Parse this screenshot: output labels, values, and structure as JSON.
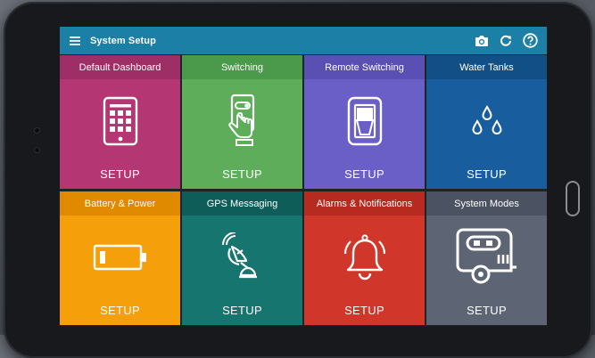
{
  "app": {
    "title": "System Setup",
    "menu_icon": "hamburger-menu-icon",
    "actions": [
      "camera-icon",
      "refresh-icon",
      "help-icon"
    ]
  },
  "tiles": [
    {
      "title": "Default Dashboard",
      "action": "SETUP",
      "icon": "tablet-dashboard-icon",
      "head_color": "#9e2e66",
      "body_color": "#b43773"
    },
    {
      "title": "Switching",
      "action": "SETUP",
      "icon": "hand-phone-switch-icon",
      "head_color": "#4b9a4b",
      "body_color": "#5ead5b"
    },
    {
      "title": "Remote Switching",
      "action": "SETUP",
      "icon": "rocker-switch-icon",
      "head_color": "#5a4fb3",
      "body_color": "#6a5ec7"
    },
    {
      "title": "Water Tanks",
      "action": "SETUP",
      "icon": "water-drops-icon",
      "head_color": "#134f87",
      "body_color": "#185e9e"
    },
    {
      "title": "Battery & Power",
      "action": "SETUP",
      "icon": "battery-icon",
      "head_color": "#e08a00",
      "body_color": "#f59f0b"
    },
    {
      "title": "GPS Messaging",
      "action": "SETUP",
      "icon": "satellite-dish-icon",
      "head_color": "#0f5d58",
      "body_color": "#16766f"
    },
    {
      "title": "Alarms & Notifications",
      "action": "SETUP",
      "icon": "bell-icon",
      "head_color": "#b62a20",
      "body_color": "#d1362a"
    },
    {
      "title": "System Modes",
      "action": "SETUP",
      "icon": "caravan-icon",
      "head_color": "#4b5261",
      "body_color": "#5d6575"
    }
  ]
}
